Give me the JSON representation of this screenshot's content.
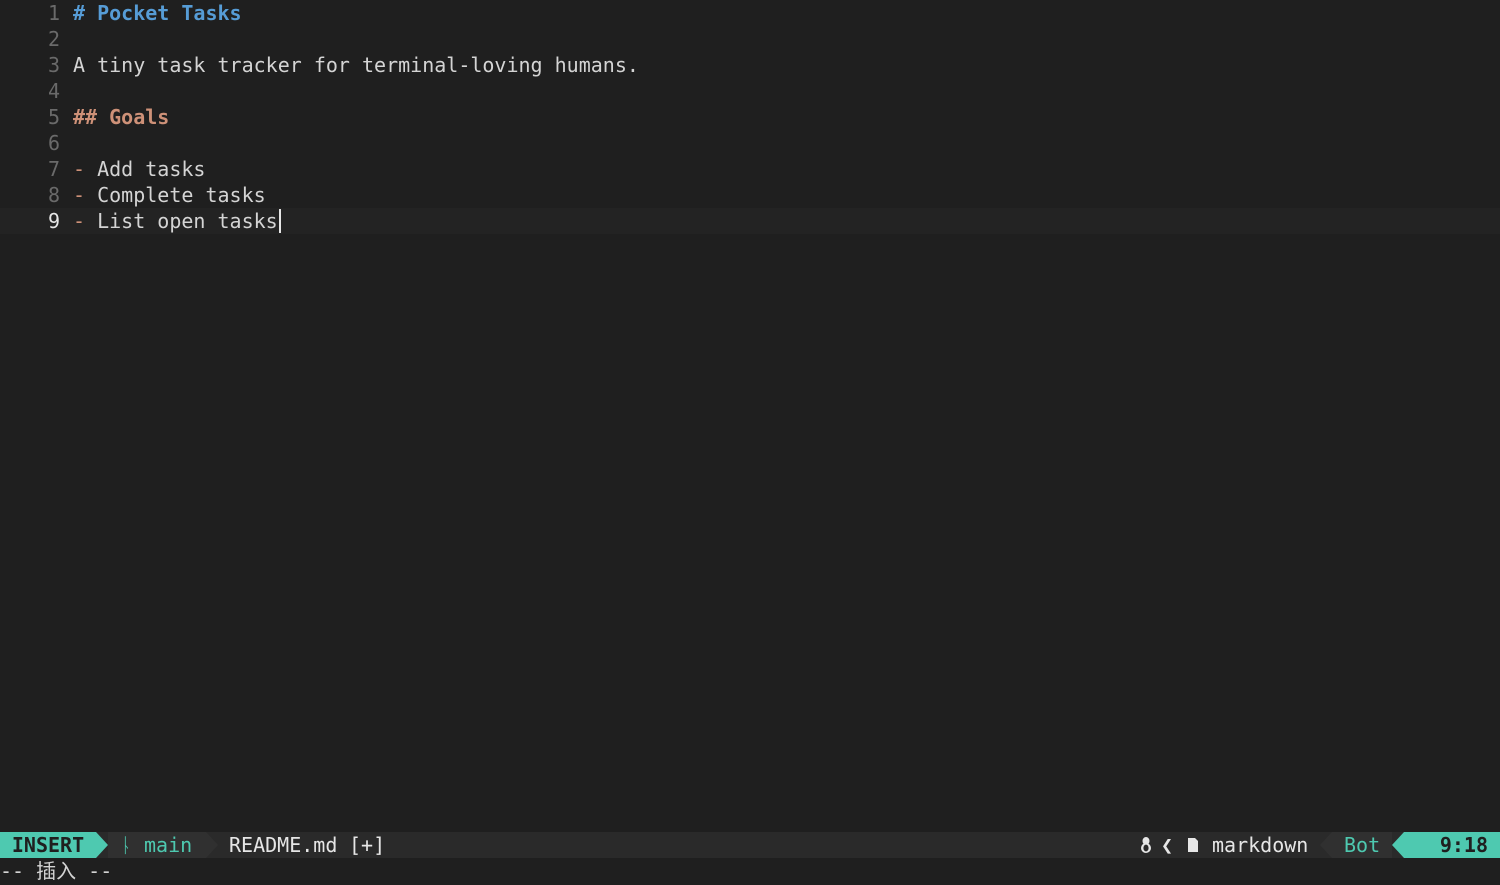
{
  "buffer": {
    "lines": [
      {
        "num": "1",
        "parts": [
          {
            "t": "# ",
            "c": "h1"
          },
          {
            "t": "Pocket Tasks",
            "c": "h1"
          }
        ]
      },
      {
        "num": "2",
        "parts": []
      },
      {
        "num": "3",
        "parts": [
          {
            "t": "A tiny task tracker for terminal-loving humans.",
            "c": "plain"
          }
        ]
      },
      {
        "num": "4",
        "parts": []
      },
      {
        "num": "5",
        "parts": [
          {
            "t": "## Goals",
            "c": "h2"
          }
        ]
      },
      {
        "num": "6",
        "parts": []
      },
      {
        "num": "7",
        "parts": [
          {
            "t": "- ",
            "c": "bullet"
          },
          {
            "t": "Add tasks",
            "c": "plain"
          }
        ]
      },
      {
        "num": "8",
        "parts": [
          {
            "t": "- ",
            "c": "bullet"
          },
          {
            "t": "Complete tasks",
            "c": "plain"
          }
        ]
      },
      {
        "num": "9",
        "parts": [
          {
            "t": "- ",
            "c": "bullet"
          },
          {
            "t": "List open tasks",
            "c": "plain"
          }
        ],
        "current": true
      }
    ]
  },
  "statusline": {
    "mode": "INSERT",
    "branch_icon": "ᚿ",
    "branch": "main",
    "filename": "README.md",
    "modified": "[+]",
    "os_icon": "🐧",
    "separator": "❮",
    "filetype_icon": "▮",
    "filetype": "markdown",
    "percent": "Bot",
    "cursor": "9:18"
  },
  "cmdline": {
    "text": "-- 插入 --"
  },
  "colors": {
    "background": "#1f1f1f",
    "accent": "#4ec9b0",
    "heading1": "#569cd6",
    "heading2": "#ce9178"
  }
}
